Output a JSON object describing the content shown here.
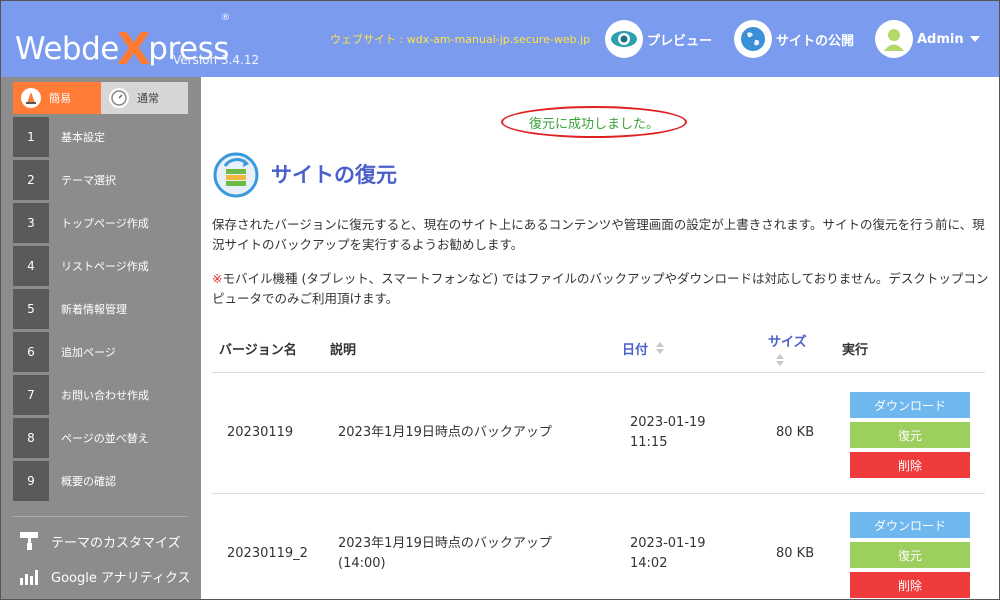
{
  "header": {
    "logo_pre": "Webde",
    "logo_x": "X",
    "logo_post": "press",
    "logo_reg": "®",
    "version": "Version 3.4.12",
    "site_url": "ウェブサイト : wdx-am-manual-jp.secure-web.jp",
    "preview_label": "プレビュー",
    "publish_label": "サイトの公開",
    "admin_label": "Admin"
  },
  "sidebar": {
    "modes": [
      {
        "label": "簡易",
        "active": true
      },
      {
        "label": "通常",
        "active": false
      }
    ],
    "items": [
      {
        "num": "1",
        "label": "基本設定"
      },
      {
        "num": "2",
        "label": "テーマ選択"
      },
      {
        "num": "3",
        "label": "トップページ作成"
      },
      {
        "num": "4",
        "label": "リストページ作成"
      },
      {
        "num": "5",
        "label": "新着情報管理"
      },
      {
        "num": "6",
        "label": "追加ページ"
      },
      {
        "num": "7",
        "label": "お問い合わせ作成"
      },
      {
        "num": "8",
        "label": "ページの並べ替え"
      },
      {
        "num": "9",
        "label": "概要の確認"
      }
    ],
    "tools": {
      "customize": "テーマのカスタマイズ",
      "analytics": "Google アナリティクス"
    }
  },
  "main": {
    "success_message": "復元に成功しました。",
    "title": "サイトの復元",
    "description": "保存されたバージョンに復元すると、現在のサイト上にあるコンテンツや管理画面の設定が上書きされます。サイトの復元を行う前に、現況サイトのバックアップを実行するようお勧めします。",
    "note_mark": "※",
    "note": "モバイル機種 (タブレット、スマートフォンなど) ではファイルのバックアップやダウンロードは対応しておりません。デスクトップコンピュータでのみご利用頂けます。",
    "table": {
      "headers": {
        "version": "バージョン名",
        "description": "説明",
        "date": "日付",
        "size": "サイズ",
        "action": "実行"
      },
      "rows": [
        {
          "version": "20230119",
          "desc1": "2023年1月19日時点のバックアップ",
          "desc2": "",
          "date": "2023-01-19",
          "time": "11:15",
          "size": "80 KB"
        },
        {
          "version": "20230119_2",
          "desc1": "2023年1月19日時点のバックアップ",
          "desc2": "(14:00)",
          "date": "2023-01-19",
          "time": "14:02",
          "size": "80 KB"
        }
      ],
      "buttons": {
        "download": "ダウンロード",
        "restore": "復元",
        "delete": "削除"
      }
    }
  },
  "colors": {
    "header_bg": "#7b9bef",
    "accent_orange": "#ff7b36",
    "sidebar_bg": "#8c8c8c",
    "title_blue": "#4a5fc9",
    "success_green": "#3aa03a",
    "btn_download": "#6fb7ef",
    "btn_restore": "#9ccf5e",
    "btn_delete": "#ef3b3b"
  }
}
